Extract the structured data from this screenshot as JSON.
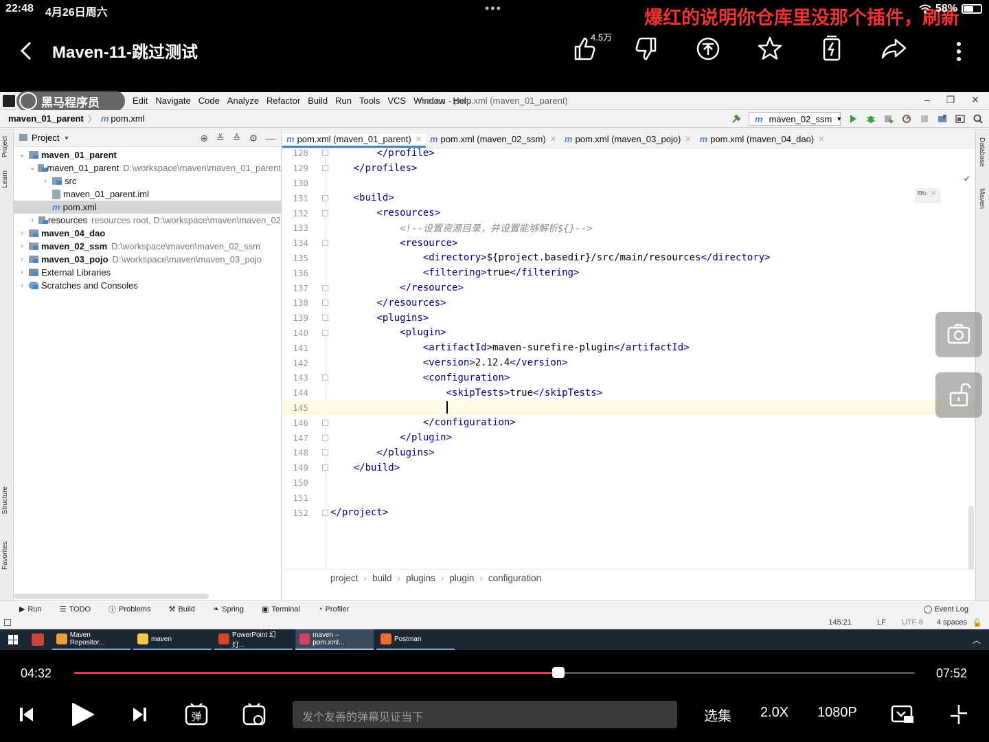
{
  "status": {
    "time": "22:48",
    "date": "4月26日周六",
    "danmaku": "爆红的说明你仓库里没那个插件，刷新",
    "battery": "58%",
    "battery_level": 0.58
  },
  "player": {
    "title": "Maven-11-跳过测试",
    "like_count": "4.5万",
    "current_time": "04:32",
    "total_time": "07:52",
    "progress": 0.576,
    "danmaku_placeholder": "发个友善的弹幕见证当下",
    "episodes": "选集",
    "speed": "2.0X",
    "quality": "1080P"
  },
  "ide": {
    "brand": "黑马程序员",
    "menus": [
      "Edit",
      "Navigate",
      "Code",
      "Analyze",
      "Refactor",
      "Build",
      "Run",
      "Tools",
      "VCS",
      "Window",
      "Help"
    ],
    "window_title": "maven - pom.xml (maven_01_parent)",
    "nav_project": "maven_01_parent",
    "nav_file": "pom.xml",
    "run_config": "maven_02_ssm",
    "panel_title": "Project",
    "tree": [
      {
        "name": "maven_01_parent",
        "bold": true,
        "path": "",
        "arrow": "⌄",
        "indent": 0,
        "icon": "folder"
      },
      {
        "name": "maven_01_parent",
        "bold": false,
        "path": "D:\\workspace\\maven\\maven_01_parent",
        "arrow": "⌄",
        "indent": 1,
        "icon": "folder"
      },
      {
        "name": "src",
        "bold": false,
        "path": "",
        "arrow": "›",
        "indent": 2,
        "icon": "folder"
      },
      {
        "name": "maven_01_parent.iml",
        "bold": false,
        "path": "",
        "arrow": "",
        "indent": 2,
        "icon": "file"
      },
      {
        "name": "pom.xml",
        "bold": false,
        "path": "",
        "arrow": "",
        "indent": 2,
        "icon": "m",
        "selected": true
      },
      {
        "name": "resources",
        "bold": false,
        "path": "resources root,  D:\\workspace\\maven\\maven_02",
        "arrow": "›",
        "indent": 1,
        "icon": "folder"
      },
      {
        "name": "maven_04_dao",
        "bold": true,
        "path": "",
        "arrow": "›",
        "indent": 0,
        "icon": "folder"
      },
      {
        "name": "maven_02_ssm",
        "bold": true,
        "path": "D:\\workspace\\maven\\maven_02_ssm",
        "arrow": "›",
        "indent": 0,
        "icon": "folder"
      },
      {
        "name": "maven_03_pojo",
        "bold": true,
        "path": "D:\\workspace\\maven\\maven_03_pojo",
        "arrow": "›",
        "indent": 0,
        "icon": "folder"
      },
      {
        "name": "External Libraries",
        "bold": false,
        "path": "",
        "arrow": "›",
        "indent": 0,
        "icon": "lib"
      },
      {
        "name": "Scratches and Consoles",
        "bold": false,
        "path": "",
        "arrow": "›",
        "indent": 0,
        "icon": "scratch"
      }
    ],
    "tabs": [
      {
        "label": "pom.xml (maven_01_parent)",
        "active": true
      },
      {
        "label": "pom.xml (maven_02_ssm)",
        "active": false
      },
      {
        "label": "pom.xml (maven_03_pojo)",
        "active": false
      },
      {
        "label": "pom.xml (maven_04_dao)",
        "active": false
      }
    ],
    "code_lines": [
      {
        "n": "128",
        "indent": 2,
        "segments": [
          {
            "t": "</profile>",
            "c": "tag"
          }
        ],
        "fold": true
      },
      {
        "n": "129",
        "indent": 1,
        "segments": [
          {
            "t": "</profiles>",
            "c": "tag"
          }
        ],
        "fold": true
      },
      {
        "n": "130",
        "indent": 0,
        "segments": []
      },
      {
        "n": "131",
        "indent": 1,
        "segments": [
          {
            "t": "<build>",
            "c": "tag"
          }
        ],
        "fold": true
      },
      {
        "n": "132",
        "indent": 2,
        "segments": [
          {
            "t": "<resources>",
            "c": "tag"
          }
        ],
        "fold": true
      },
      {
        "n": "133",
        "indent": 3,
        "segments": [
          {
            "t": "<!--设置资源目录，并设置能够解析${}-->",
            "c": "comment"
          }
        ]
      },
      {
        "n": "134",
        "indent": 3,
        "segments": [
          {
            "t": "<resource>",
            "c": "tag"
          }
        ],
        "fold": true
      },
      {
        "n": "135",
        "indent": 4,
        "segments": [
          {
            "t": "<directory>",
            "c": "tag"
          },
          {
            "t": "${project.basedir}/src/main/resources",
            "c": "plain"
          },
          {
            "t": "</directory>",
            "c": "tag"
          }
        ]
      },
      {
        "n": "136",
        "indent": 4,
        "segments": [
          {
            "t": "<filtering>",
            "c": "tag"
          },
          {
            "t": "true",
            "c": "plain"
          },
          {
            "t": "</filtering>",
            "c": "tag"
          }
        ]
      },
      {
        "n": "137",
        "indent": 3,
        "segments": [
          {
            "t": "</resource>",
            "c": "tag"
          }
        ],
        "fold": true
      },
      {
        "n": "138",
        "indent": 2,
        "segments": [
          {
            "t": "</resources>",
            "c": "tag"
          }
        ],
        "fold": true
      },
      {
        "n": "139",
        "indent": 2,
        "segments": [
          {
            "t": "<plugins>",
            "c": "tag"
          }
        ],
        "fold": true
      },
      {
        "n": "140",
        "indent": 3,
        "segments": [
          {
            "t": "<plugin>",
            "c": "tag"
          }
        ],
        "fold": true
      },
      {
        "n": "141",
        "indent": 4,
        "segments": [
          {
            "t": "<artifactId>",
            "c": "tag"
          },
          {
            "t": "maven-surefire-plugin",
            "c": "plain"
          },
          {
            "t": "</artifactId>",
            "c": "tag"
          }
        ]
      },
      {
        "n": "142",
        "indent": 4,
        "segments": [
          {
            "t": "<version>",
            "c": "tag"
          },
          {
            "t": "2.12.4",
            "c": "plain"
          },
          {
            "t": "</version>",
            "c": "tag"
          }
        ]
      },
      {
        "n": "143",
        "indent": 4,
        "segments": [
          {
            "t": "<configuration>",
            "c": "tag"
          }
        ],
        "fold": true
      },
      {
        "n": "144",
        "indent": 5,
        "segments": [
          {
            "t": "<skipTests>",
            "c": "tag"
          },
          {
            "t": "true",
            "c": "plain"
          },
          {
            "t": "</skipTests>",
            "c": "tag"
          }
        ]
      },
      {
        "n": "145",
        "indent": 5,
        "segments": [],
        "current": true,
        "caret": true
      },
      {
        "n": "146",
        "indent": 4,
        "segments": [
          {
            "t": "</configuration>",
            "c": "tag"
          }
        ],
        "fold": true
      },
      {
        "n": "147",
        "indent": 3,
        "segments": [
          {
            "t": "</plugin>",
            "c": "tag"
          }
        ],
        "fold": true
      },
      {
        "n": "148",
        "indent": 2,
        "segments": [
          {
            "t": "</plugins>",
            "c": "tag"
          }
        ],
        "fold": true
      },
      {
        "n": "149",
        "indent": 1,
        "segments": [
          {
            "t": "</build>",
            "c": "tag"
          }
        ],
        "fold": true
      },
      {
        "n": "150",
        "indent": 0,
        "segments": []
      },
      {
        "n": "151",
        "indent": 0,
        "segments": []
      },
      {
        "n": "152",
        "indent": 0,
        "segments": [
          {
            "t": "</project>",
            "c": "tag"
          }
        ],
        "fold": true
      }
    ],
    "breadcrumb": [
      "project",
      "build",
      "plugins",
      "plugin",
      "configuration"
    ],
    "tool_windows": [
      "Run",
      "TODO",
      "Problems",
      "Build",
      "Spring",
      "Terminal",
      "Profiler"
    ],
    "event_log": "Event Log",
    "left_strip": [
      "Project",
      "Learn",
      "Structure",
      "Favorites"
    ],
    "right_strip": [
      "Database",
      "Maven"
    ],
    "cursor_pos": "145:21",
    "line_sep": "LF",
    "encoding": "UTF-8",
    "indent_info": "4 spaces",
    "taskbar": [
      {
        "label": "Maven Repositor...",
        "color": "#e9a23b",
        "state": "open"
      },
      {
        "label": "maven",
        "color": "#f1c84b",
        "state": "open"
      },
      {
        "label": "PowerPoint 幻灯...",
        "color": "#d24726",
        "state": "open"
      },
      {
        "label": "maven – pom.xml...",
        "color": "#d43e6a",
        "state": "active"
      },
      {
        "label": "Postman",
        "color": "#ef6c2b",
        "state": "open"
      }
    ]
  }
}
